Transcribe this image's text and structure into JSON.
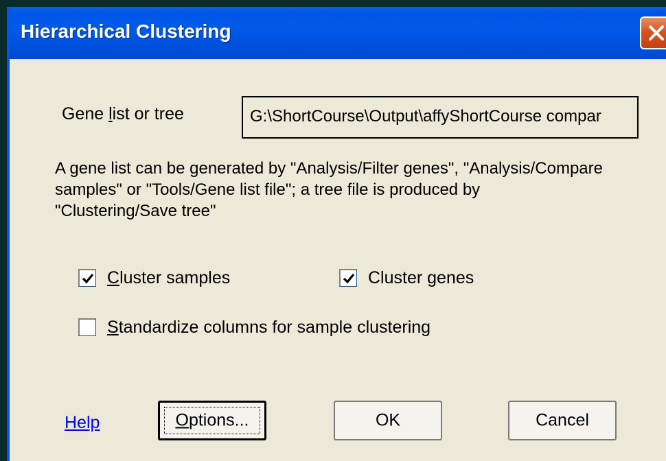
{
  "window": {
    "title": "Hierarchical Clustering"
  },
  "gene_list": {
    "label_prefix": "Gene ",
    "label_underlined": "l",
    "label_suffix": "ist or tree",
    "value": "G:\\ShortCourse\\Output\\affyShortCourse compar"
  },
  "description": {
    "line1": "A gene list can be generated by \"Analysis/Filter genes\", \"Analysis/Compare",
    "line2": "samples\" or \"Tools/Gene list file\"; a tree file is produced by",
    "line3": "\"Clustering/Save tree\""
  },
  "options": {
    "cluster_samples": {
      "underlined": "C",
      "rest": "luster samples",
      "checked": true
    },
    "cluster_genes": {
      "prefix": "Cluster ",
      "underlined": "g",
      "rest": "enes",
      "checked": true
    },
    "standardize": {
      "underlined": "S",
      "rest": "tandardize columns for sample clustering",
      "checked": false
    }
  },
  "buttons": {
    "help": "Help",
    "options_underlined": "O",
    "options_rest": "ptions...",
    "ok": "OK",
    "cancel": "Cancel"
  },
  "colors": {
    "titlebar": "#0055ea",
    "dialog_bg": "#ece9d8",
    "close_button": "#d9531f",
    "link": "#0000ff"
  },
  "icons": {
    "close": "close-icon",
    "checkmark": "checkmark-icon"
  }
}
